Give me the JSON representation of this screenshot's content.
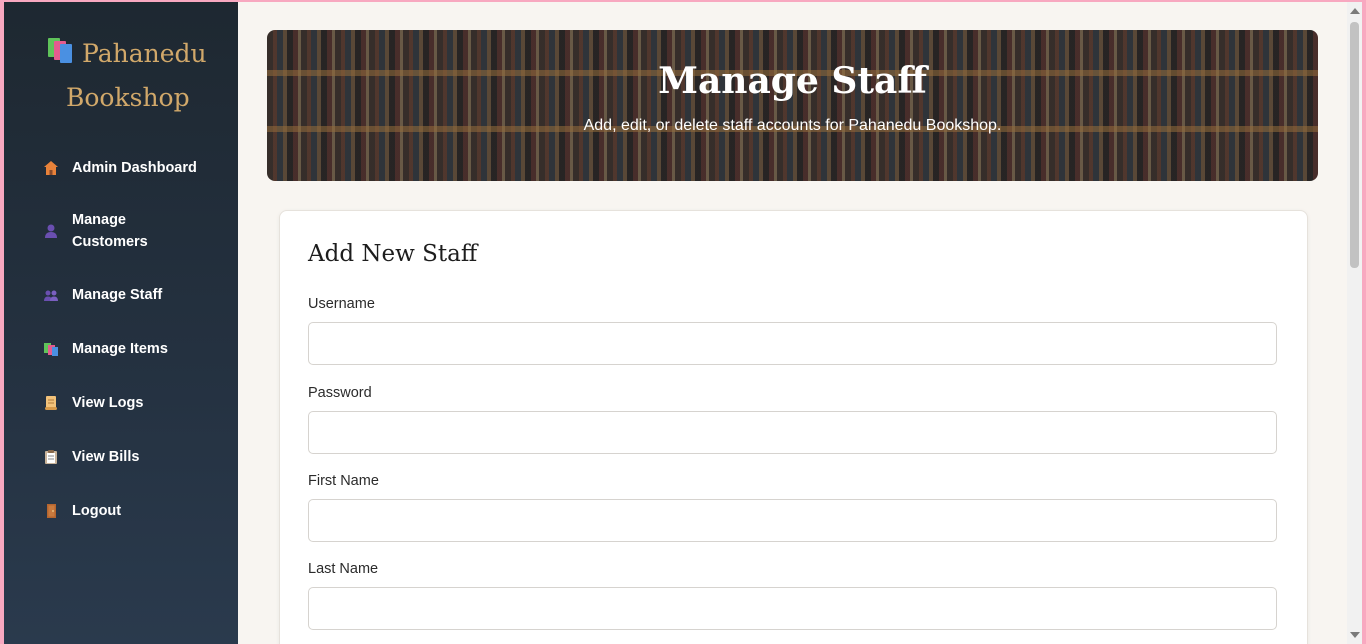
{
  "sidebar": {
    "brand_line1": "Pahanedu",
    "brand_line2": "Bookshop",
    "items": [
      {
        "label": "Admin Dashboard",
        "icon": "house-icon"
      },
      {
        "label": "Manage Customers",
        "icon": "person-icon"
      },
      {
        "label": "Manage Staff",
        "icon": "people-icon"
      },
      {
        "label": "Manage Items",
        "icon": "books-icon"
      },
      {
        "label": "View Logs",
        "icon": "scroll-icon"
      },
      {
        "label": "View Bills",
        "icon": "clipboard-icon"
      },
      {
        "label": "Logout",
        "icon": "door-icon"
      }
    ],
    "brand_color": "#d1a86a"
  },
  "hero": {
    "title": "Manage Staff",
    "subtitle": "Add, edit, or delete staff accounts for Pahanedu Bookshop."
  },
  "form": {
    "title": "Add New Staff",
    "fields": [
      {
        "label": "Username",
        "value": ""
      },
      {
        "label": "Password",
        "value": ""
      },
      {
        "label": "First Name",
        "value": ""
      },
      {
        "label": "Last Name",
        "value": ""
      }
    ]
  }
}
